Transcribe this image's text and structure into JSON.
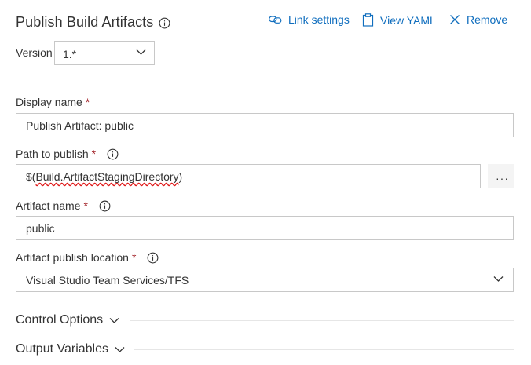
{
  "header": {
    "title": "Publish Build Artifacts",
    "link_settings": "Link settings",
    "view_yaml": "View YAML",
    "remove": "Remove"
  },
  "version": {
    "label": "Version",
    "value": "1.*"
  },
  "display_name": {
    "label": "Display name",
    "required_mark": "*",
    "value": "Publish Artifact: public"
  },
  "path_to_publish": {
    "label": "Path to publish",
    "required_mark": "*",
    "value_prefix": "$(",
    "value_misspelled": "Build.ArtifactStagingDirectory",
    "value_suffix": ")",
    "more_label": "···"
  },
  "artifact_name": {
    "label": "Artifact name",
    "required_mark": "*",
    "value": "public"
  },
  "publish_location": {
    "label": "Artifact publish location",
    "required_mark": "*",
    "value": "Visual Studio Team Services/TFS"
  },
  "sections": {
    "control_options": "Control Options",
    "output_variables": "Output Variables"
  },
  "colors": {
    "link": "#106ebe",
    "required": "#a4262c",
    "border": "#c8c8c8",
    "spellcheck": "#e01b1b"
  },
  "icons": {
    "title_info": "info-icon",
    "link_settings": "link-icon",
    "view_yaml": "clipboard-icon",
    "remove": "close-icon",
    "dropdown": "chevron-down-icon",
    "more": "ellipsis-icon"
  }
}
